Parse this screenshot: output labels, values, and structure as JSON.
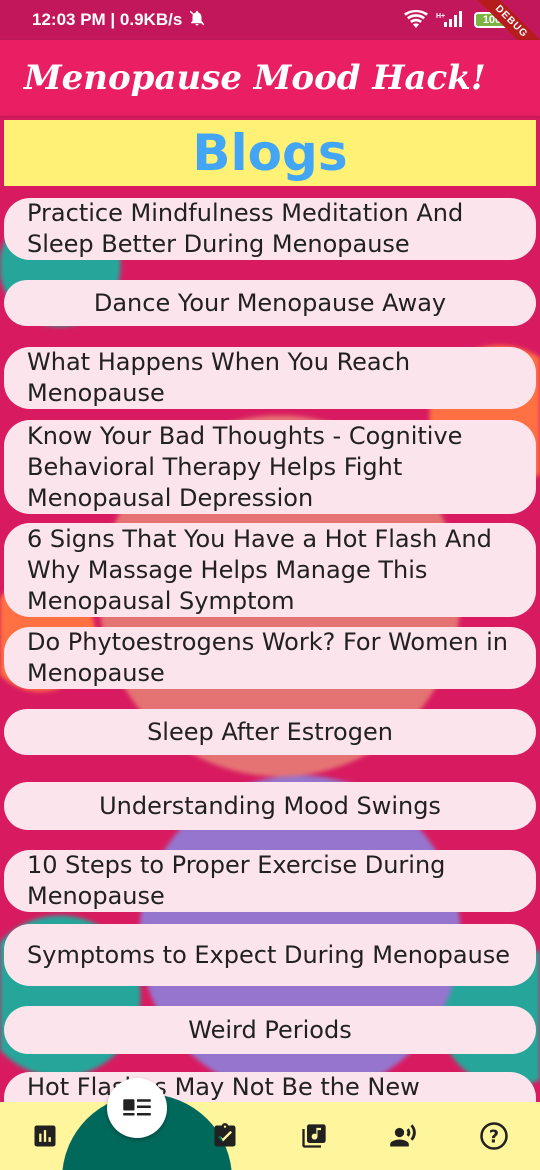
{
  "status_bar": {
    "time_speed": "12:03 PM | 0.9KB/s",
    "battery": "100",
    "debug_label": "DEBUG"
  },
  "app_bar": {
    "title": "Menopause Mood Hack!"
  },
  "blogs_header": {
    "title": "Blogs"
  },
  "blog_items": [
    {
      "title": "Practice Mindfulness Meditation And Sleep Better During Menopause"
    },
    {
      "title": "Dance Your Menopause Away"
    },
    {
      "title": "What Happens When You Reach Menopause"
    },
    {
      "title": "Know Your Bad Thoughts - Cognitive Behavioral Therapy Helps Fight Menopausal Depression"
    },
    {
      "title": "6 Signs That You Have a Hot Flash And Why Massage Helps Manage This Menopausal Symptom"
    },
    {
      "title": "Do Phytoestrogens Work? For Women in Menopause"
    },
    {
      "title": "Sleep After Estrogen"
    },
    {
      "title": "Understanding Mood Swings"
    },
    {
      "title": "10 Steps to Proper Exercise During Menopause"
    },
    {
      "title": "Symptoms to Expect During Menopause"
    },
    {
      "title": "Weird Periods"
    },
    {
      "title": "Hot Flashes May Not Be the New"
    }
  ],
  "bottom_nav": {
    "items": [
      {
        "icon": "bar-chart-icon"
      },
      {
        "icon": "article-icon",
        "active": true
      },
      {
        "icon": "assignment-check-icon"
      },
      {
        "icon": "music-library-icon"
      },
      {
        "icon": "record-voice-icon"
      },
      {
        "icon": "help-icon"
      }
    ]
  },
  "colors": {
    "status_bar": "#c2185b",
    "app_bar": "#e91e63",
    "blogs_header_bg": "#fff176",
    "blogs_title": "#42a5f5",
    "blog_item_bg": "#fce4ec",
    "bottom_nav_bg": "#fff59d",
    "nav_hump": "#00695c"
  }
}
